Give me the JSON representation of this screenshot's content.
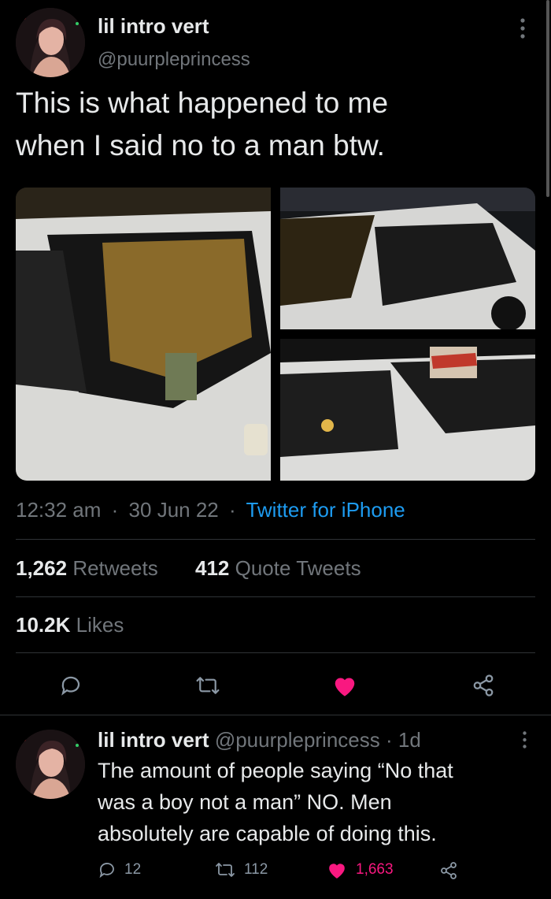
{
  "tweet": {
    "display_name": "lil intro vert",
    "handle": "@puurpleprincess",
    "text_line1": "This is what happened to me",
    "text_line2": "when I said no to a man btw.",
    "time": "12:32 am",
    "date": "30 Jun 22",
    "source": "Twitter for iPhone",
    "retweets_count": "1,262",
    "retweets_label": "Retweets",
    "quotes_count": "412",
    "quotes_label": "Quote Tweets",
    "likes_count": "10.2K",
    "likes_label": "Likes"
  },
  "reply": {
    "display_name": "lil intro vert",
    "handle": "@puurpleprincess",
    "age": "1d",
    "text_line1": "The amount of people saying “No that",
    "text_line2": "was a boy not a man” NO. Men",
    "text_line3": "absolutely are capable of doing this.",
    "reply_count": "12",
    "retweet_count": "112",
    "like_count": "1,663"
  },
  "colors": {
    "link": "#1d9bf0",
    "like": "#f91880",
    "muted": "#71767b"
  },
  "separators": {
    "dot": "·"
  }
}
